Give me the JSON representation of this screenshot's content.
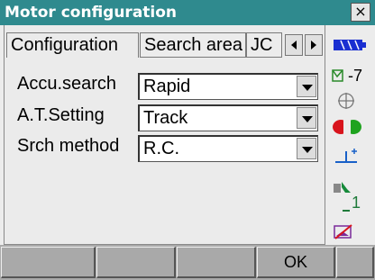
{
  "window": {
    "title": "Motor configuration",
    "close_label": "×"
  },
  "tabs": [
    {
      "label": "Configuration",
      "active": true
    },
    {
      "label": "Search area",
      "active": false
    },
    {
      "label": "JC",
      "active": false
    }
  ],
  "fields": [
    {
      "label": "Accu.search",
      "value": "Rapid"
    },
    {
      "label": "A.T.Setting",
      "value": "Track"
    },
    {
      "label": "Srch method",
      "value": "R.C."
    }
  ],
  "status": {
    "tilt_value": "-7",
    "channel_value": "1",
    "battery_color": "#1a2fd1",
    "target_left_color": "#d8141d",
    "target_right_color": "#1fa31f"
  },
  "softkeys": [
    "",
    "",
    "",
    "OK",
    ""
  ]
}
